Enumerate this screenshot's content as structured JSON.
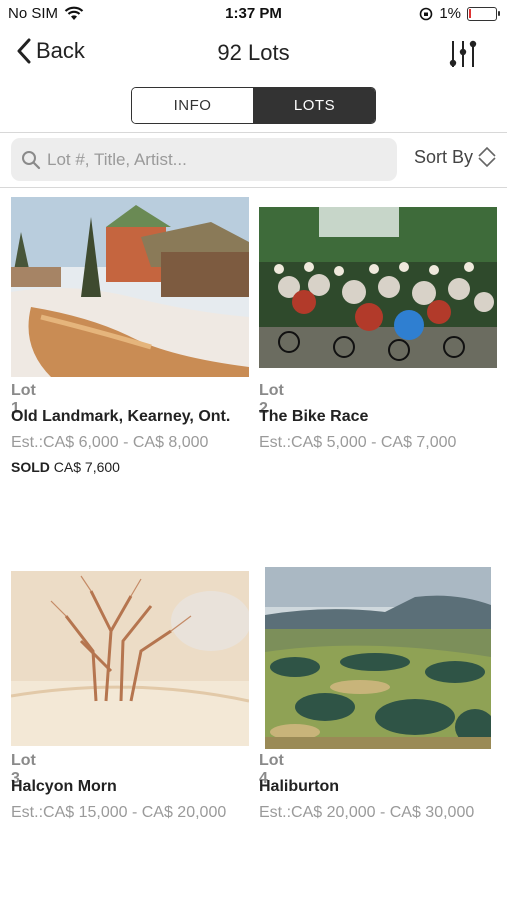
{
  "status_bar": {
    "carrier": "No SIM",
    "time": "1:37 PM",
    "battery": "1%",
    "icons": [
      "wifi-icon",
      "orientation-lock-icon",
      "battery-icon"
    ]
  },
  "nav": {
    "back_label": "Back",
    "title": "92 Lots",
    "filter_icon": "sliders-icon"
  },
  "tabs": [
    {
      "label": "INFO",
      "selected": false
    },
    {
      "label": "LOTS",
      "selected": true
    }
  ],
  "search": {
    "placeholder": "Lot #, Title, Artist...",
    "value": ""
  },
  "sort": {
    "label": "Sort By",
    "icon": "sort-chevrons-icon"
  },
  "lots": [
    {
      "number": "Lot 1",
      "title": "Old Landmark, Kearney, Ont.",
      "estimate": "Est.:CA$ 6,000 - CA$ 8,000",
      "sold_label": "SOLD",
      "sold_price": "CA$ 7,600"
    },
    {
      "number": "Lot 2",
      "title": "The Bike Race",
      "estimate": "Est.:CA$ 5,000 - CA$ 7,000"
    },
    {
      "number": "Lot 3",
      "title": "Halcyon Morn",
      "estimate": "Est.:CA$ 15,000 - CA$ 20,000"
    },
    {
      "number": "Lot 4",
      "title": "Haliburton",
      "estimate": "Est.:CA$ 20,000 - CA$ 30,000"
    }
  ],
  "colors": {
    "segment_active": "#333333",
    "search_bg": "#ededed",
    "muted_text": "#9a9a9a"
  }
}
